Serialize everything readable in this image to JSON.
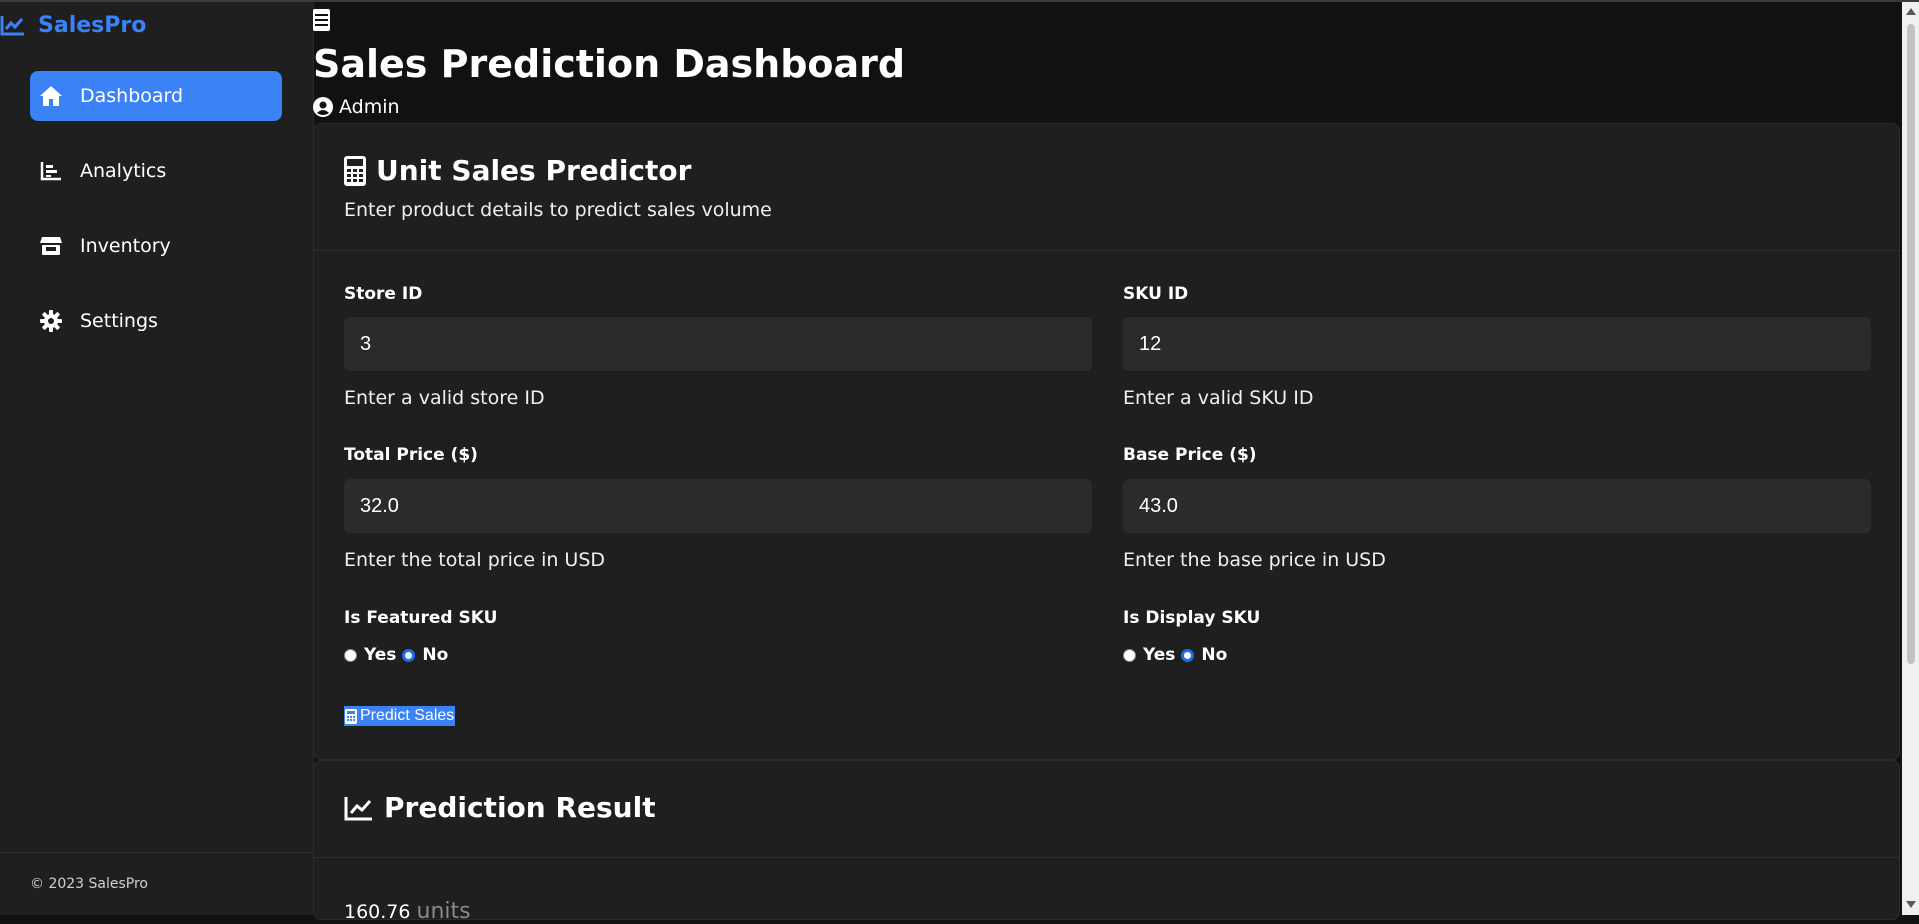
{
  "app": {
    "brand": "SalesPro",
    "brand_color": "#3b82f6"
  },
  "sidebar": {
    "items": [
      {
        "label": "Dashboard",
        "icon": "home-icon",
        "active": true
      },
      {
        "label": "Analytics",
        "icon": "bar-chart-icon",
        "active": false
      },
      {
        "label": "Inventory",
        "icon": "store-icon",
        "active": false
      },
      {
        "label": "Settings",
        "icon": "gear-icon",
        "active": false
      }
    ],
    "footer": "© 2023 SalesPro"
  },
  "header": {
    "title": "Sales Prediction Dashboard",
    "user": "Admin"
  },
  "predictor": {
    "title": "Unit Sales Predictor",
    "subtitle": "Enter product details to predict sales volume",
    "fields": {
      "store_id": {
        "label": "Store ID",
        "value": "3",
        "help": "Enter a valid store ID"
      },
      "sku_id": {
        "label": "SKU ID",
        "value": "12",
        "help": "Enter a valid SKU ID"
      },
      "total_price": {
        "label": "Total Price ($)",
        "value": "32.0",
        "help": "Enter the total price in USD"
      },
      "base_price": {
        "label": "Base Price ($)",
        "value": "43.0",
        "help": "Enter the base price in USD"
      }
    },
    "featured": {
      "label": "Is Featured SKU",
      "yes": "Yes",
      "no": "No",
      "selected": "No"
    },
    "display": {
      "label": "Is Display SKU",
      "yes": "Yes",
      "no": "No",
      "selected": "No"
    },
    "button": "Predict Sales"
  },
  "result": {
    "title": "Prediction Result",
    "value": "160.76",
    "unit": "units"
  }
}
